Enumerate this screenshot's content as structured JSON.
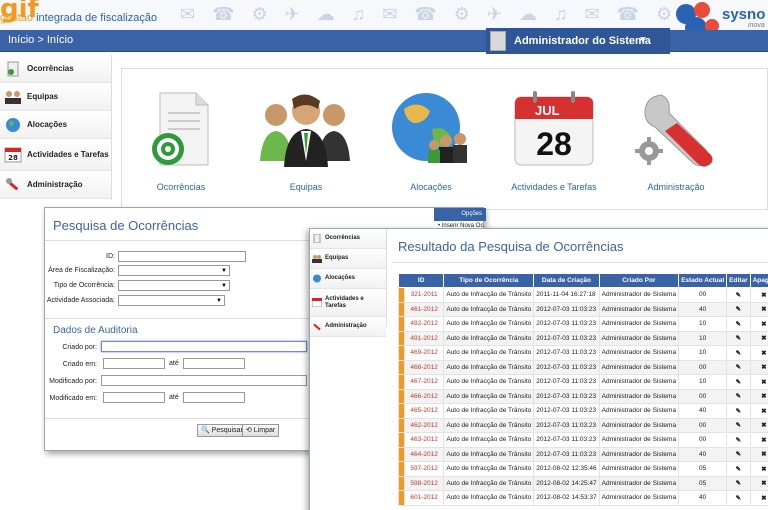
{
  "header": {
    "logo_mark": "gif",
    "logo_sub_prefix": "gestão",
    "logo_sub": " integrada de fiscalização",
    "brand": "sysno",
    "brand_sub": "inova",
    "pattern": "✉ ☎ ⚙ ✈ ☁ ♫ ✉ ☎ ⚙ ✈ ☁ ♫ ✉ ☎ ⚙"
  },
  "navbar": {
    "breadcrumb": "Início > Início",
    "user": "Administrador do Sistema",
    "caret": "▼"
  },
  "sidebar": {
    "items": [
      {
        "label": "Ocorrências",
        "icon": "document-icon"
      },
      {
        "label": "Equipas",
        "icon": "people-icon"
      },
      {
        "label": "Alocações",
        "icon": "globe-icon"
      },
      {
        "label": "Actividades e Tarefas",
        "icon": "calendar-icon"
      },
      {
        "label": "Administração",
        "icon": "tools-icon"
      }
    ]
  },
  "dashboard": {
    "tiles": [
      {
        "label": "Ocorrências",
        "icon": "document-target-icon"
      },
      {
        "label": "Equipas",
        "icon": "people-icon"
      },
      {
        "label": "Alocações",
        "icon": "globe-people-icon"
      },
      {
        "label": "Actividades e Tarefas",
        "icon": "calendar-icon",
        "cal_month": "JUL",
        "cal_day": "28"
      },
      {
        "label": "Administração",
        "icon": "wrench-gear-icon"
      }
    ]
  },
  "search": {
    "title": "Pesquisa de Ocorrências",
    "options_title": "Opções",
    "options_item": "• Inserir Nova Oc",
    "id_label": "ID:",
    "area_label": "Área de Fiscalização:",
    "tipo_label": "Tipo de Ocorrência:",
    "actividade_label": "Actividade Associada:",
    "audit_title": "Dados de Auditoria",
    "criado_por_label": "Criado por:",
    "criado_em_label": "Criado em:",
    "modificado_por_label": "Modificado por:",
    "modificado_em_label": "Modificado em:",
    "ate_label": "até",
    "btn_search": "🔍 Pesquisar",
    "btn_clear": "⟲ Limpar"
  },
  "results": {
    "title": "Resultado da Pesquisa de Ocorrências",
    "sidebar": [
      {
        "label": "Ocorrências"
      },
      {
        "label": "Equipas"
      },
      {
        "label": "Alocações"
      },
      {
        "label": "Actividades e Tarefas"
      },
      {
        "label": "Administração"
      }
    ],
    "columns": [
      "ID",
      "Tipo de Ocorrência",
      "Data de Criação",
      "Criado Por",
      "Estado Actual",
      "Editar",
      "Apagar"
    ],
    "rows": [
      [
        "321-2011",
        "Auto de Infracção de Trânsito",
        "2011-11-04 16:27:18",
        "Administrador de Sistema",
        "00"
      ],
      [
        "461-2012",
        "Auto de Infracção de Trânsito",
        "2012-07-03 11:03:23",
        "Administrador de Sistema",
        "40"
      ],
      [
        "492-2012",
        "Auto de Infracção de Trânsito",
        "2012-07-03 11:03:23",
        "Administrador de Sistema",
        "10"
      ],
      [
        "491-2012",
        "Auto de Infracção de Trânsito",
        "2012-07-03 11:03:23",
        "Administrador de Sistema",
        "10"
      ],
      [
        "469-2012",
        "Auto de Infracção de Trânsito",
        "2012-07-03 11:03:23",
        "Administrador de Sistema",
        "10"
      ],
      [
        "468-2012",
        "Auto de Infracção de Trânsito",
        "2012-07-03 11:03:23",
        "Administrador de Sistema",
        "00"
      ],
      [
        "467-2012",
        "Auto de Infracção de Trânsito",
        "2012-07-03 11:03:23",
        "Administrador de Sistema",
        "10"
      ],
      [
        "466-2012",
        "Auto de Infracção de Trânsito",
        "2012-07-03 11:03:23",
        "Administrador de Sistema",
        "00"
      ],
      [
        "465-2012",
        "Auto de Infracção de Trânsito",
        "2012-07-03 11:03:23",
        "Administrador de Sistema",
        "40"
      ],
      [
        "462-2012",
        "Auto de Infracção de Trânsito",
        "2012-07-03 11:03:23",
        "Administrador de Sistema",
        "00"
      ],
      [
        "463-2012",
        "Auto de Infracção de Trânsito",
        "2012-07-03 11:03:23",
        "Administrador de Sistema",
        "00"
      ],
      [
        "464-2012",
        "Auto de Infracção de Trânsito",
        "2012-07-03 11:03:23",
        "Administrador de Sistema",
        "40"
      ],
      [
        "597-2012",
        "Auto de Infracção de Trânsito",
        "2012-08-02 12:35:46",
        "Administrador de Sistema",
        "05"
      ],
      [
        "598-2012",
        "Auto de Infracção de Trânsito",
        "2012-08-02 14:25:47",
        "Administrador de Sistema",
        "05"
      ],
      [
        "601-2012",
        "Auto de Infracção de Trânsito",
        "2012-08-02 14:53:37",
        "Administrador de Sistema",
        "40"
      ]
    ],
    "edit_glyph": "✎",
    "delete_glyph": "✖"
  },
  "colors": {
    "primary": "#3a63a7",
    "accent": "#f39a1e",
    "delete": "#dd2222"
  }
}
